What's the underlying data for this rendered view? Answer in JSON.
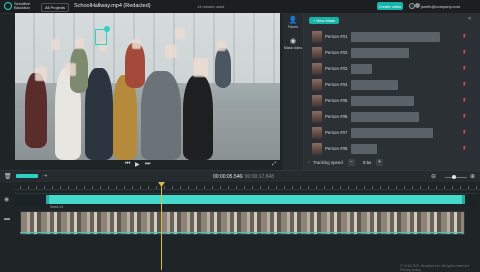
{
  "topbar": {
    "logo_text": "Sensitive Blackbox",
    "projects_label": "All Projects",
    "project_title": "SchoolHallway.mp4 (Redacted)",
    "usage_text": "14 minute used",
    "create_label": "Create video",
    "help_icon": "help-icon",
    "user_email": "jsmith@company.com"
  },
  "sidenav": {
    "items": [
      {
        "label": "Faces",
        "icon": "user-icon"
      },
      {
        "label": "Mask video",
        "icon": "eye-icon"
      }
    ]
  },
  "panel": {
    "new_mask_label": "+ New Mask",
    "rows": [
      {
        "label": "Person #01",
        "fill": 0.85
      },
      {
        "label": "Person #02",
        "fill": 0.55
      },
      {
        "label": "Person #03",
        "fill": 0.2
      },
      {
        "label": "Person #04",
        "fill": 0.45
      },
      {
        "label": "Person #05",
        "fill": 0.6
      },
      {
        "label": "Person #06",
        "fill": 0.65
      },
      {
        "label": "Person #07",
        "fill": 0.78
      },
      {
        "label": "Person #08",
        "fill": 0.25
      }
    ],
    "tracking_label": "Tracking speed",
    "tracking_value": "0.5x",
    "minus_label": "−",
    "plus_label": "+"
  },
  "timeline": {
    "current_time": "00:00:05.546",
    "total_time": "/ 00:00:17.848",
    "mask_name": "Mask #1"
  },
  "footer": "© 2019-2021 Sensitive Inc. All rights reserved. Privacy policy",
  "colors": {
    "accent": "#16b3a8",
    "mask_band": "#45d9cc",
    "playhead": "#d9b94a",
    "danger": "#c0474f"
  }
}
